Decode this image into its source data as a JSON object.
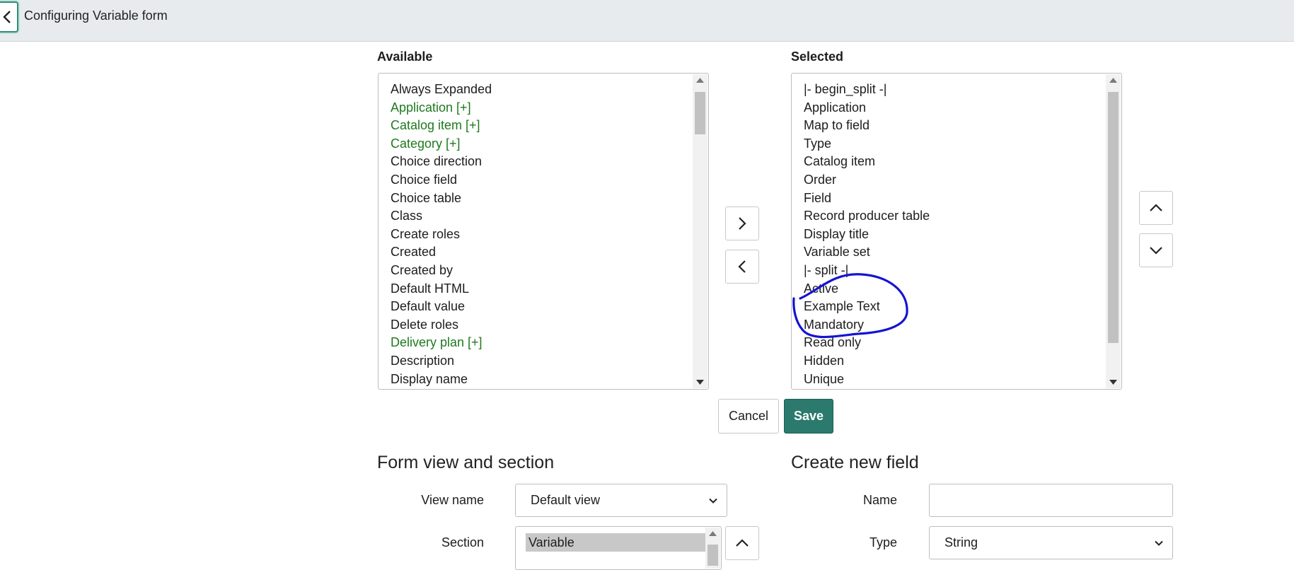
{
  "header": {
    "title": "Configuring Variable form",
    "back_icon": "chevron-left-icon"
  },
  "available": {
    "label": "Available",
    "items": [
      {
        "text": "Always Expanded",
        "color": "#1d1d1d"
      },
      {
        "text": "Application [+]",
        "color": "#1e7a1e"
      },
      {
        "text": "Catalog item [+]",
        "color": "#1e7a1e"
      },
      {
        "text": "Category [+]",
        "color": "#1e7a1e"
      },
      {
        "text": "Choice direction",
        "color": "#1d1d1d"
      },
      {
        "text": "Choice field",
        "color": "#1d1d1d"
      },
      {
        "text": "Choice table",
        "color": "#1d1d1d"
      },
      {
        "text": "Class",
        "color": "#1d1d1d"
      },
      {
        "text": "Create roles",
        "color": "#1d1d1d"
      },
      {
        "text": "Created",
        "color": "#1d1d1d"
      },
      {
        "text": "Created by",
        "color": "#1d1d1d"
      },
      {
        "text": "Default HTML",
        "color": "#1d1d1d"
      },
      {
        "text": "Default value",
        "color": "#1d1d1d"
      },
      {
        "text": "Delete roles",
        "color": "#1d1d1d"
      },
      {
        "text": "Delivery plan [+]",
        "color": "#1e7a1e"
      },
      {
        "text": "Description",
        "color": "#1d1d1d"
      },
      {
        "text": "Display name",
        "color": "#1d1d1d"
      }
    ]
  },
  "selected": {
    "label": "Selected",
    "items": [
      "|- begin_split -|",
      "Application",
      "Map to field",
      "Type",
      "Catalog item",
      "Order",
      "Field",
      "Record producer table",
      "Display title",
      "Variable set",
      "|- split -|",
      "Active",
      "Example Text",
      "Mandatory",
      "Read only",
      "Hidden",
      "Unique"
    ]
  },
  "transfer": {
    "add_icon": "chevron-right-icon",
    "remove_icon": "chevron-left-icon"
  },
  "reorder": {
    "up_icon": "chevron-up-icon",
    "down_icon": "chevron-down-icon"
  },
  "actions": {
    "cancel_label": "Cancel",
    "save_label": "Save"
  },
  "form_view": {
    "title": "Form view and section",
    "view_name_label": "View name",
    "view_name_value": "Default view",
    "section_label": "Section",
    "section_value": "Variable"
  },
  "new_field": {
    "title": "Create new field",
    "name_label": "Name",
    "name_value": "",
    "type_label": "Type",
    "type_value": "String"
  },
  "colors": {
    "accent": "#2b7a6d",
    "reference_field": "#1e7a1e",
    "annotation": "#1414d2",
    "header_bg": "#e8ebee"
  }
}
